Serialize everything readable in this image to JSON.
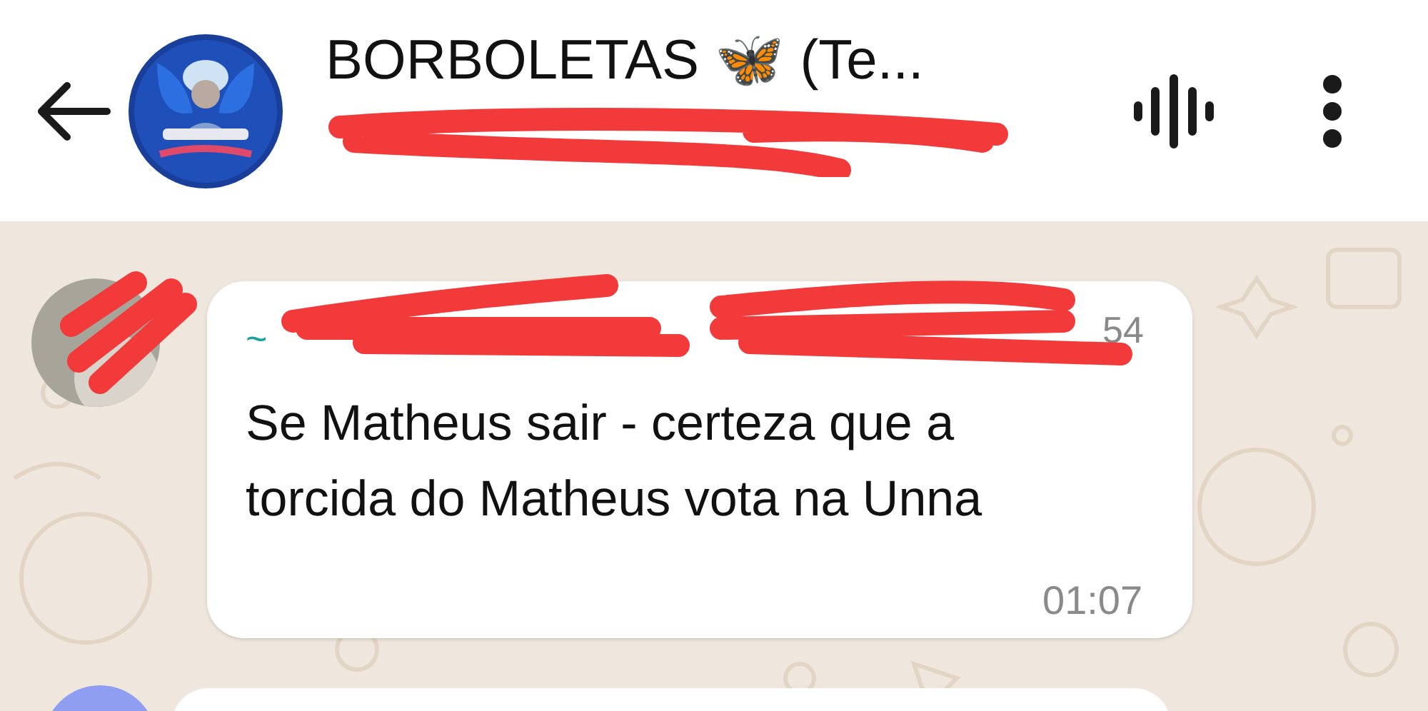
{
  "header": {
    "title": "BORBOLETAS 🦋 (Te..."
  },
  "messages": [
    {
      "kind": "incoming",
      "sender": "~",
      "time_fragment": "54",
      "text": "Se Matheus sair - certeza que a torcida do Matheus vota na Unna",
      "time": "01:07"
    },
    {
      "kind": "incoming_partial"
    }
  ]
}
